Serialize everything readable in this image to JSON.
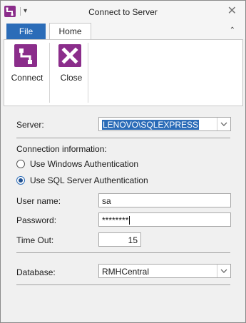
{
  "window": {
    "title": "Connect to Server"
  },
  "qat": {
    "dropdown_glyph": "▾"
  },
  "titlebar": {
    "close_glyph": "✕"
  },
  "ribbon": {
    "tabs": [
      {
        "label": "File"
      },
      {
        "label": "Home"
      }
    ],
    "collapse_glyph": "⌃",
    "buttons": [
      {
        "label": "Connect",
        "icon": "connect-icon"
      },
      {
        "label": "Close",
        "icon": "close-icon"
      }
    ]
  },
  "form": {
    "server": {
      "label": "Server:",
      "value": "LENOVO\\SQLEXPRESS"
    },
    "connection_info": {
      "label": "Connection information:"
    },
    "auth": {
      "options": [
        {
          "label": "Use Windows Authentication",
          "selected": false
        },
        {
          "label": "Use SQL Server Authentication",
          "selected": true
        }
      ]
    },
    "username": {
      "label": "User name:",
      "value": "sa"
    },
    "password": {
      "label": "Password:",
      "value": "********"
    },
    "timeout": {
      "label": "Time Out:",
      "value": "15"
    },
    "database": {
      "label": "Database:",
      "value": "RMHCentral"
    }
  },
  "colors": {
    "accent": "#2b6cb8",
    "brand": "#8b2d8b"
  }
}
